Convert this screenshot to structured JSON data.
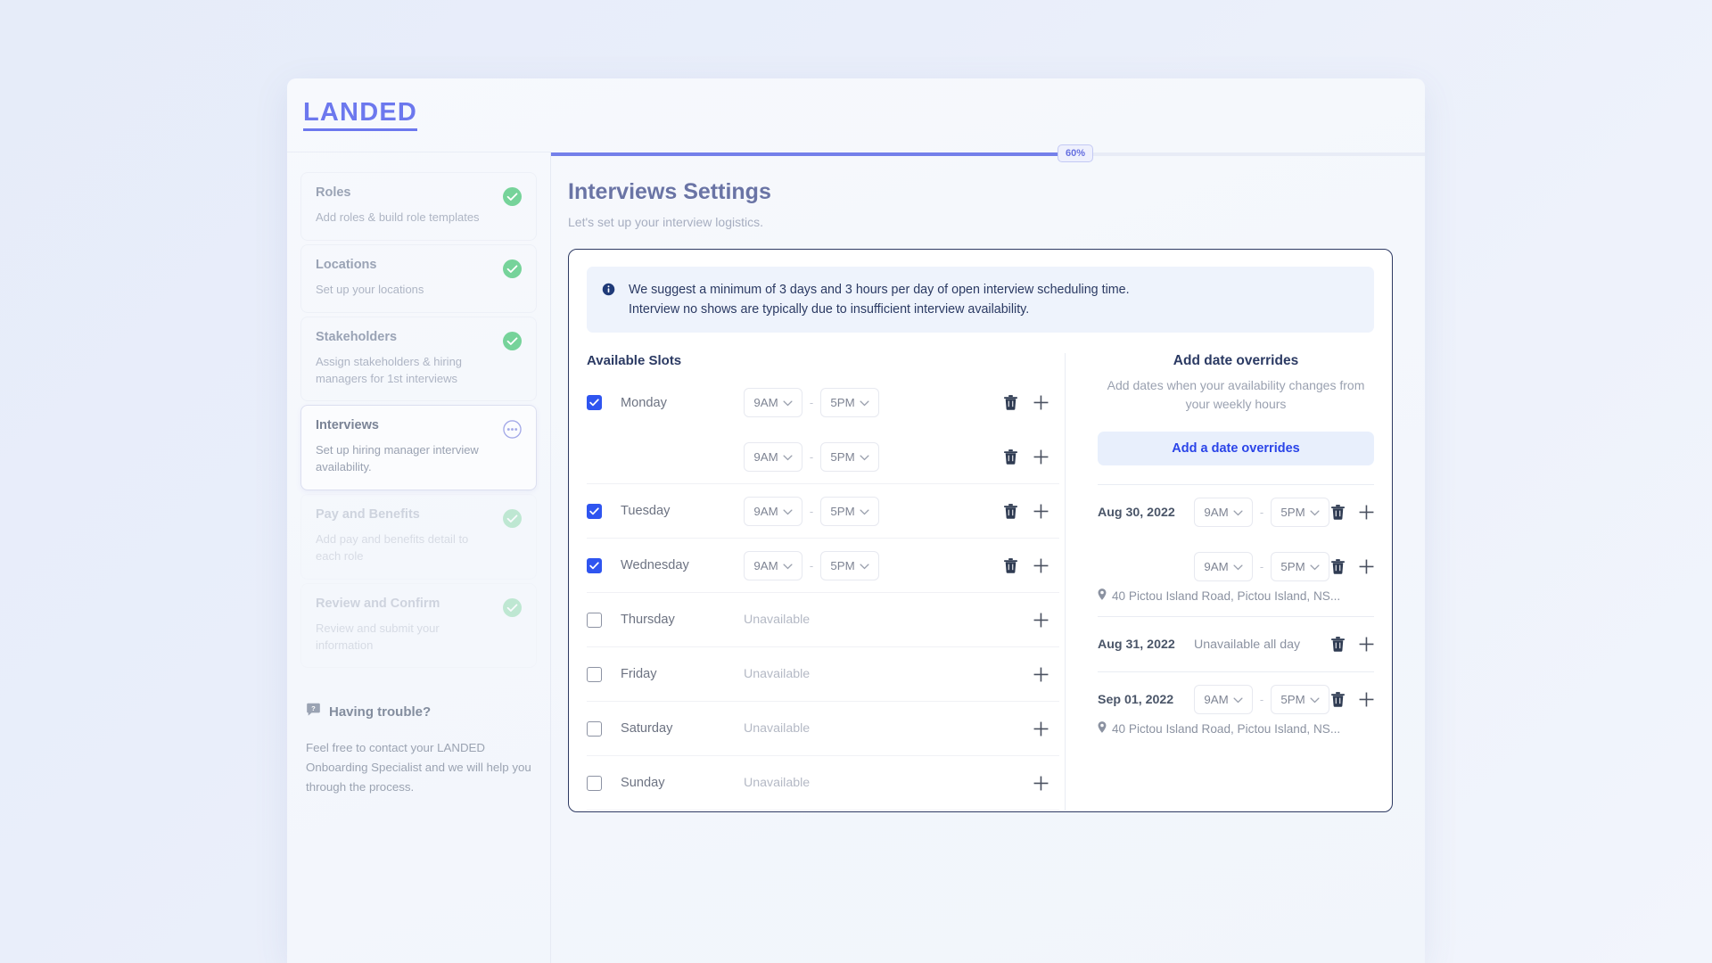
{
  "brand": {
    "name": "LANDED"
  },
  "progress": {
    "percent_label": "60%",
    "value": 60
  },
  "header": {
    "title": "Interviews Settings",
    "subtitle": "Let's set up your interview logistics."
  },
  "sidebar": {
    "steps": [
      {
        "title": "Roles",
        "desc": "Add roles & build role templates",
        "state": "complete",
        "badge": "check-circle-icon"
      },
      {
        "title": "Locations",
        "desc": "Set up your locations",
        "state": "complete",
        "badge": "check-circle-icon"
      },
      {
        "title": "Stakeholders",
        "desc": "Assign stakeholders & hiring managers for 1st interviews",
        "state": "complete",
        "badge": "check-circle-icon"
      },
      {
        "title": "Interviews",
        "desc": "Set up hiring manager interview availability.",
        "state": "active",
        "badge": "ellipsis-circle-icon"
      },
      {
        "title": "Pay and Benefits",
        "desc": "Add pay and benefits detail to each role",
        "state": "upcoming",
        "badge": "check-circle-icon"
      },
      {
        "title": "Review and Confirm",
        "desc": "Review and submit your information",
        "state": "upcoming",
        "badge": "check-circle-icon"
      }
    ],
    "help": {
      "title": "Having trouble?",
      "icon": "question-bubble-icon",
      "body": "Feel free to contact your LANDED Onboarding Specialist and we will help you through the process."
    }
  },
  "notice": {
    "icon": "info-icon",
    "line1": "We suggest a minimum of 3 days and 3 hours per day of open interview scheduling time.",
    "line2": "Interview no shows are typically due to insufficient interview availability."
  },
  "available_slots": {
    "title": "Available Slots",
    "dash": "-",
    "unavailable_label": "Unavailable",
    "days": [
      {
        "name": "Monday",
        "checked": true,
        "available": true,
        "slots": [
          {
            "start": "9AM",
            "end": "5PM",
            "has_delete": true,
            "has_add": true
          },
          {
            "start": "9AM",
            "end": "5PM",
            "has_delete": true,
            "has_add": true
          }
        ]
      },
      {
        "name": "Tuesday",
        "checked": true,
        "available": true,
        "slots": [
          {
            "start": "9AM",
            "end": "5PM",
            "has_delete": true,
            "has_add": true
          }
        ]
      },
      {
        "name": "Wednesday",
        "checked": true,
        "available": true,
        "slots": [
          {
            "start": "9AM",
            "end": "5PM",
            "has_delete": true,
            "has_add": true
          }
        ]
      },
      {
        "name": "Thursday",
        "checked": false,
        "available": false,
        "slots": []
      },
      {
        "name": "Friday",
        "checked": false,
        "available": false,
        "slots": []
      },
      {
        "name": "Saturday",
        "checked": false,
        "available": false,
        "slots": []
      },
      {
        "name": "Sunday",
        "checked": false,
        "available": false,
        "slots": []
      }
    ]
  },
  "date_overrides": {
    "title": "Add date overrides",
    "subtitle": "Add dates when your availability changes from your weekly hours",
    "button_label": "Add a date overrides",
    "dash": "-",
    "entries": [
      {
        "date": "Aug 30, 2022",
        "all_day_unavailable": false,
        "slots": [
          {
            "start": "9AM",
            "end": "5PM"
          },
          {
            "start": "9AM",
            "end": "5PM"
          }
        ],
        "location": "40 Pictou Island Road, Pictou Island, NS..."
      },
      {
        "date": "Aug 31, 2022",
        "all_day_unavailable": true,
        "unavailable_label": "Unavailable all day",
        "slots": [],
        "location": ""
      },
      {
        "date": "Sep 01, 2022",
        "all_day_unavailable": false,
        "slots": [
          {
            "start": "9AM",
            "end": "5PM"
          }
        ],
        "location": "40 Pictou Island Road, Pictou Island, NS..."
      }
    ]
  },
  "colors": {
    "brand": "#6c78ee",
    "progress": "#7480ea",
    "checkbox_on": "#2f55f0",
    "complete_badge": "#76d39a",
    "panel_border": "#2e3a63",
    "notice_bg": "#eef3fc",
    "link": "#2a44e8"
  },
  "icons": {
    "delete": "trash-icon",
    "add": "plus-icon",
    "chevron": "chevron-down-icon",
    "location": "map-pin-icon"
  }
}
